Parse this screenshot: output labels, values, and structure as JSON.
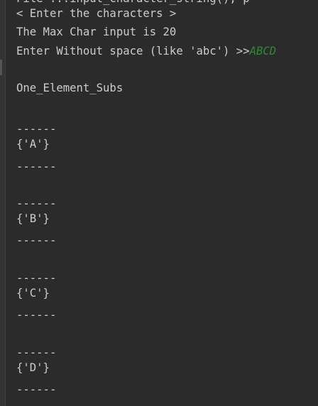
{
  "console": {
    "clipped_line": "File ...input_character_string(), p",
    "prompt_line": "< Enter the characters >",
    "max_char_line": "The Max Char input is 20",
    "enter_prompt": "Enter Without space (like 'abc') >>",
    "user_input": "ABCD",
    "section_title": "One_Element_Subs",
    "separator": "------",
    "subsets": [
      "{'A'}",
      "{'B'}",
      "{'C'}",
      "{'D'}"
    ]
  }
}
